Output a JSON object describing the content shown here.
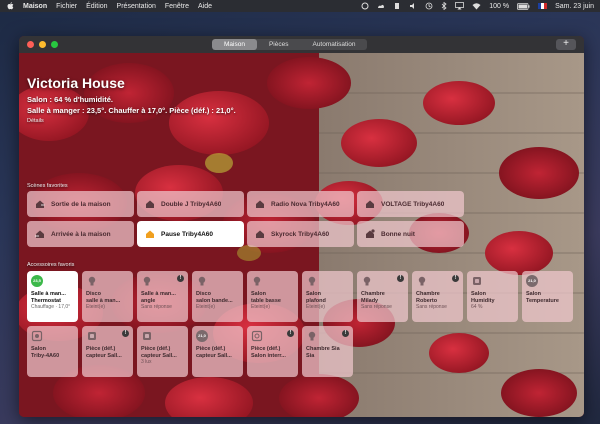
{
  "menubar": {
    "app_name": "Maison",
    "menus": [
      "Fichier",
      "Édition",
      "Présentation",
      "Fenêtre",
      "Aide"
    ],
    "battery": "100 %",
    "datetime": "Sam. 23 juin"
  },
  "window": {
    "tabs": [
      {
        "label": "Maison",
        "active": true
      },
      {
        "label": "Pièces",
        "active": false
      },
      {
        "label": "Automatisation",
        "active": false
      }
    ],
    "add_label": "+"
  },
  "home": {
    "title": "Victoria House",
    "status_line1": "Salon : 64 % d'humidité.",
    "status_line2": "Salle à manger : 23,5°. Chauffer à 17,0°. Pièce (déf.) : 21,0°.",
    "details": "Détails"
  },
  "scenes": {
    "label": "Scènes favorites",
    "items": [
      {
        "label": "Sortie de la maison",
        "icon": "house-leave-icon",
        "active": false
      },
      {
        "label": "Double J Triby4A60",
        "icon": "house-icon",
        "active": false
      },
      {
        "label": "Radio Nova Triby4A60",
        "icon": "house-icon",
        "active": false
      },
      {
        "label": "VOLTAGE Triby4A60",
        "icon": "house-icon",
        "active": false
      },
      {
        "label": "Arrivée à la maison",
        "icon": "house-arrive-icon",
        "active": false
      },
      {
        "label": "Pause Triby4A60",
        "icon": "house-icon",
        "active": true
      },
      {
        "label": "Skyrock Triby4A60",
        "icon": "house-icon",
        "active": false
      },
      {
        "label": "Bonne nuit",
        "icon": "moon-house-icon",
        "active": false
      }
    ]
  },
  "accessories": {
    "label": "Accessoires favoris",
    "items": [
      {
        "l1": "Salle à man...",
        "l2": "Thermostat",
        "l3": "Chauffage · 17,0°",
        "icon": "temp",
        "badge": "23,5",
        "active": true,
        "alert": false
      },
      {
        "l1": "Disco",
        "l2": "salle à man...",
        "l3": "Éteint(e)",
        "icon": "bulb-icon",
        "active": false,
        "alert": false
      },
      {
        "l1": "Salle à man...",
        "l2": "angle",
        "l3": "Sans réponse",
        "icon": "bulb-icon",
        "active": false,
        "alert": true
      },
      {
        "l1": "Disco",
        "l2": "salon bande...",
        "l3": "Éteint(e)",
        "icon": "bulb-icon",
        "active": false,
        "alert": false
      },
      {
        "l1": "Salon",
        "l2": "table basse",
        "l3": "Éteint(e)",
        "icon": "bulb-icon",
        "active": false,
        "alert": false
      },
      {
        "l1": "Salon",
        "l2": "plafond",
        "l3": "Éteint(e)",
        "icon": "bulb-icon",
        "active": false,
        "alert": false
      },
      {
        "l1": "Chambre",
        "l2": "Milady",
        "l3": "Sans réponse",
        "icon": "bulb-icon",
        "active": false,
        "alert": true
      },
      {
        "l1": "Chambre",
        "l2": "Roberto",
        "l3": "Sans réponse",
        "icon": "bulb-icon",
        "active": false,
        "alert": true
      },
      {
        "l1": "Salon",
        "l2": "Humidity",
        "l3": "64 %",
        "icon": "sensor-icon",
        "active": false,
        "alert": false
      },
      {
        "l1": "Salon",
        "l2": "Temperature",
        "l3": "",
        "icon": "temp",
        "badge": "21,0",
        "active": false,
        "alert": false
      },
      {
        "l1": "Salon",
        "l2": "Triby-4A60",
        "l3": "",
        "icon": "speaker-icon",
        "active": false,
        "alert": false
      },
      {
        "l1": "Pièce (déf.)",
        "l2": "capteur Sall...",
        "l3": "",
        "icon": "sensor-icon",
        "active": false,
        "alert": true
      },
      {
        "l1": "Pièce (déf.)",
        "l2": "capteur Sall...",
        "l3": "3 lux",
        "icon": "sensor-icon",
        "active": false,
        "alert": false
      },
      {
        "l1": "Pièce (déf.)",
        "l2": "capteur Sall...",
        "l3": "",
        "icon": "temp",
        "badge": "21,0",
        "active": false,
        "alert": false
      },
      {
        "l1": "Pièce (déf.)",
        "l2": "Salon interr...",
        "l3": "",
        "icon": "switch-icon",
        "active": false,
        "alert": true
      },
      {
        "l1": "Chambre Sia",
        "l2": "Sia",
        "l3": "",
        "icon": "bulb-icon",
        "active": false,
        "alert": true
      }
    ]
  },
  "colors": {
    "tile_bg": "#f0c8cd",
    "active_tile_bg": "#ffffff",
    "scene_icon": "#5a3b40",
    "active_scene_icon": "#f0a020",
    "thermostat_green": "#3cb84a"
  }
}
